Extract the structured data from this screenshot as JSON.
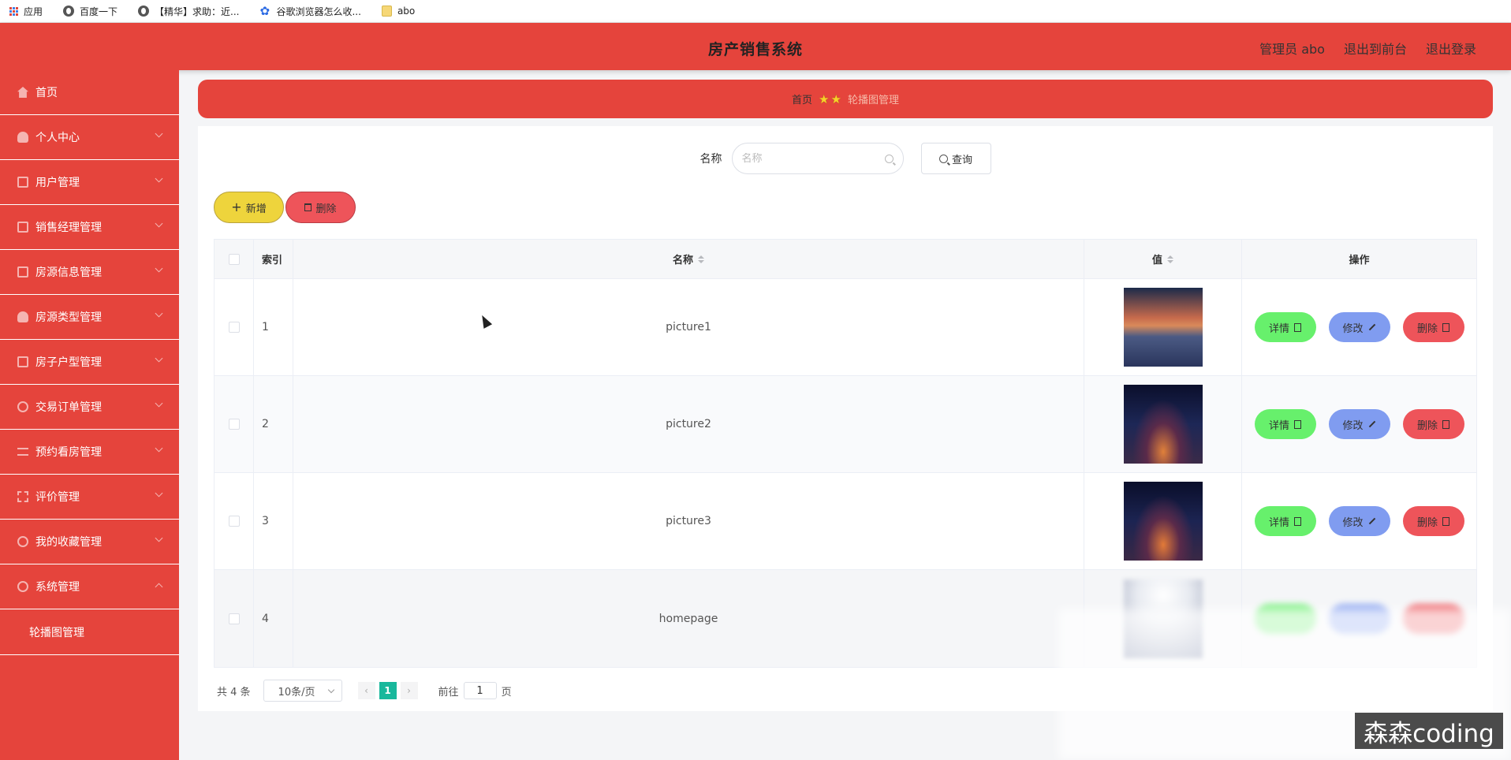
{
  "bookmarks": [
    {
      "label": "应用",
      "icon": "apps-grid-icon"
    },
    {
      "label": "百度一下",
      "icon": "globe-icon"
    },
    {
      "label": "【精华】求助：近...",
      "icon": "globe-icon"
    },
    {
      "label": "谷歌浏览器怎么收...",
      "icon": "paw-icon"
    },
    {
      "label": "abo",
      "icon": "folder-icon"
    }
  ],
  "header": {
    "title": "房产销售系统",
    "admin_label": "管理员 abo",
    "back_to_front": "退出到前台",
    "logout": "退出登录",
    "accent_color": "#e5443c"
  },
  "sidebar": {
    "items": [
      {
        "label": "首页",
        "icon": "home-icon"
      },
      {
        "label": "个人中心",
        "icon": "user-icon"
      },
      {
        "label": "用户管理",
        "icon": "monitor-icon"
      },
      {
        "label": "销售经理管理",
        "icon": "clipboard-icon"
      },
      {
        "label": "房源信息管理",
        "icon": "briefcase-icon"
      },
      {
        "label": "房源类型管理",
        "icon": "user-icon"
      },
      {
        "label": "房子户型管理",
        "icon": "monitor-icon"
      },
      {
        "label": "交易订单管理",
        "icon": "ring-icon"
      },
      {
        "label": "预约看房管理",
        "icon": "list-icon"
      },
      {
        "label": "评价管理",
        "icon": "frame-icon"
      },
      {
        "label": "我的收藏管理",
        "icon": "power-icon"
      },
      {
        "label": "系统管理",
        "icon": "gauge-icon"
      }
    ],
    "sub_item": "轮播图管理"
  },
  "breadcrumb": {
    "home": "首页",
    "current": "轮播图管理"
  },
  "search": {
    "label": "名称",
    "placeholder": "名称",
    "button": "查询"
  },
  "actions": {
    "add": "新增",
    "delete": "删除"
  },
  "table": {
    "columns": [
      "索引",
      "名称",
      "值",
      "操作"
    ],
    "rows": [
      {
        "index": "1",
        "name": "picture1"
      },
      {
        "index": "2",
        "name": "picture2"
      },
      {
        "index": "3",
        "name": "picture3"
      },
      {
        "index": "4",
        "name": "homepage"
      }
    ],
    "row_actions": {
      "detail": "详情",
      "edit": "修改",
      "delete": "删除"
    }
  },
  "pagination": {
    "total": "共 4 条",
    "page_size": "10条/页",
    "current_page": "1",
    "goto_label": "前往",
    "goto_value": "1",
    "page_suffix": "页"
  },
  "watermark": "森森coding"
}
